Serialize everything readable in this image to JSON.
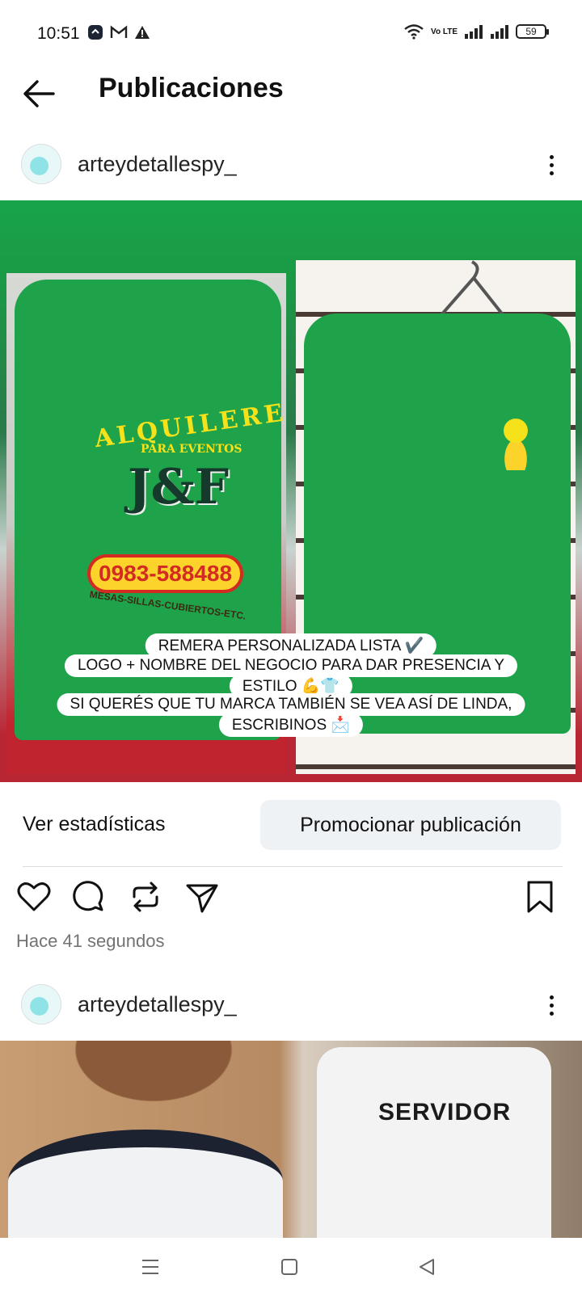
{
  "status_bar": {
    "time": "10:51",
    "battery": "59",
    "volte": "Vo LTE"
  },
  "header": {
    "title": "Publicaciones"
  },
  "post1": {
    "username": "arteydetallespy_",
    "image": {
      "logo_arc": "ALQUILERES",
      "logo_sub": "PARA EVENTOS",
      "logo_mark": "J&F",
      "phone": "0983-588488",
      "logo_footer": "MESAS-SILLAS-CUBIERTOS-ETC.",
      "caption_lines": [
        "REMERA PERSONALIZADA LISTA ✔️",
        "LOGO + NOMBRE DEL NEGOCIO PARA DAR PRESENCIA Y",
        "ESTILO 💪👕",
        "SI QUERÉS QUE TU MARCA TAMBIÉN SE VEA ASÍ DE LINDA,",
        "ESCRIBINOS 📩"
      ]
    },
    "stats_label": "Ver estadísticas",
    "promote_label": "Promocionar publicación",
    "timestamp": "Hace 41 segundos"
  },
  "post2": {
    "username": "arteydetallespy_",
    "image": {
      "vest_text": "SERVIDOR"
    }
  },
  "icons": {
    "like": "heart-icon",
    "comment": "comment-icon",
    "repost": "repost-icon",
    "share": "send-icon",
    "save": "bookmark-icon",
    "back": "arrow-left-icon",
    "more": "more-vertical-icon"
  },
  "colors": {
    "shirt_green": "#1fa34a",
    "promote_bg": "#eff2f5",
    "muted_text": "#737373"
  }
}
